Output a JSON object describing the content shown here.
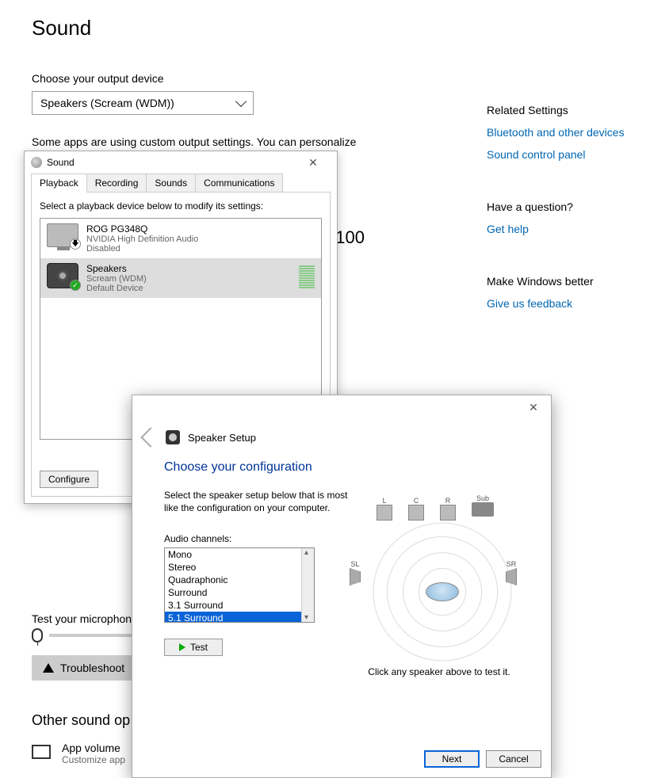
{
  "page": {
    "title": "Sound",
    "output_label": "Choose your output device",
    "output_selected": "Speakers (Scream (WDM))",
    "custom_note": "Some apps are using custom output settings. You can personalize",
    "volume": "100",
    "mic_label": "Test your microphone",
    "troubleshoot": "Troubleshoot",
    "other_heading": "Other sound op",
    "appvol_title": "App volume",
    "appvol_desc": "Customize app"
  },
  "side": {
    "h1": "Related Settings",
    "link1": "Bluetooth and other devices",
    "link2": "Sound control panel",
    "h2": "Have a question?",
    "link3": "Get help",
    "h3": "Make Windows better",
    "link4": "Give us feedback"
  },
  "sound_dlg": {
    "title": "Sound",
    "tabs": {
      "playback": "Playback",
      "recording": "Recording",
      "sounds": "Sounds",
      "comm": "Communications"
    },
    "instruction": "Select a playback device below to modify its settings:",
    "dev0": {
      "name": "ROG PG348Q",
      "meta1": "NVIDIA High Definition Audio",
      "meta2": "Disabled"
    },
    "dev1": {
      "name": "Speakers",
      "meta1": "Scream (WDM)",
      "meta2": "Default Device"
    },
    "configure": "Configure"
  },
  "wizard": {
    "title": "Speaker Setup",
    "heading": "Choose your configuration",
    "instruction": "Select the speaker setup below that is most like the configuration on your computer.",
    "channels_label": "Audio channels:",
    "channels": [
      "Mono",
      "Stereo",
      "Quadraphonic",
      "Surround",
      "3.1 Surround",
      "5.1 Surround",
      "5.1 Surround"
    ],
    "selected_channel_index": 5,
    "test": "Test",
    "click_hint": "Click any speaker above to test it.",
    "speakers": {
      "l": "L",
      "c": "C",
      "r": "R",
      "sub": "Sub",
      "sl": "SL",
      "sr": "SR"
    },
    "next": "Next",
    "cancel": "Cancel"
  }
}
